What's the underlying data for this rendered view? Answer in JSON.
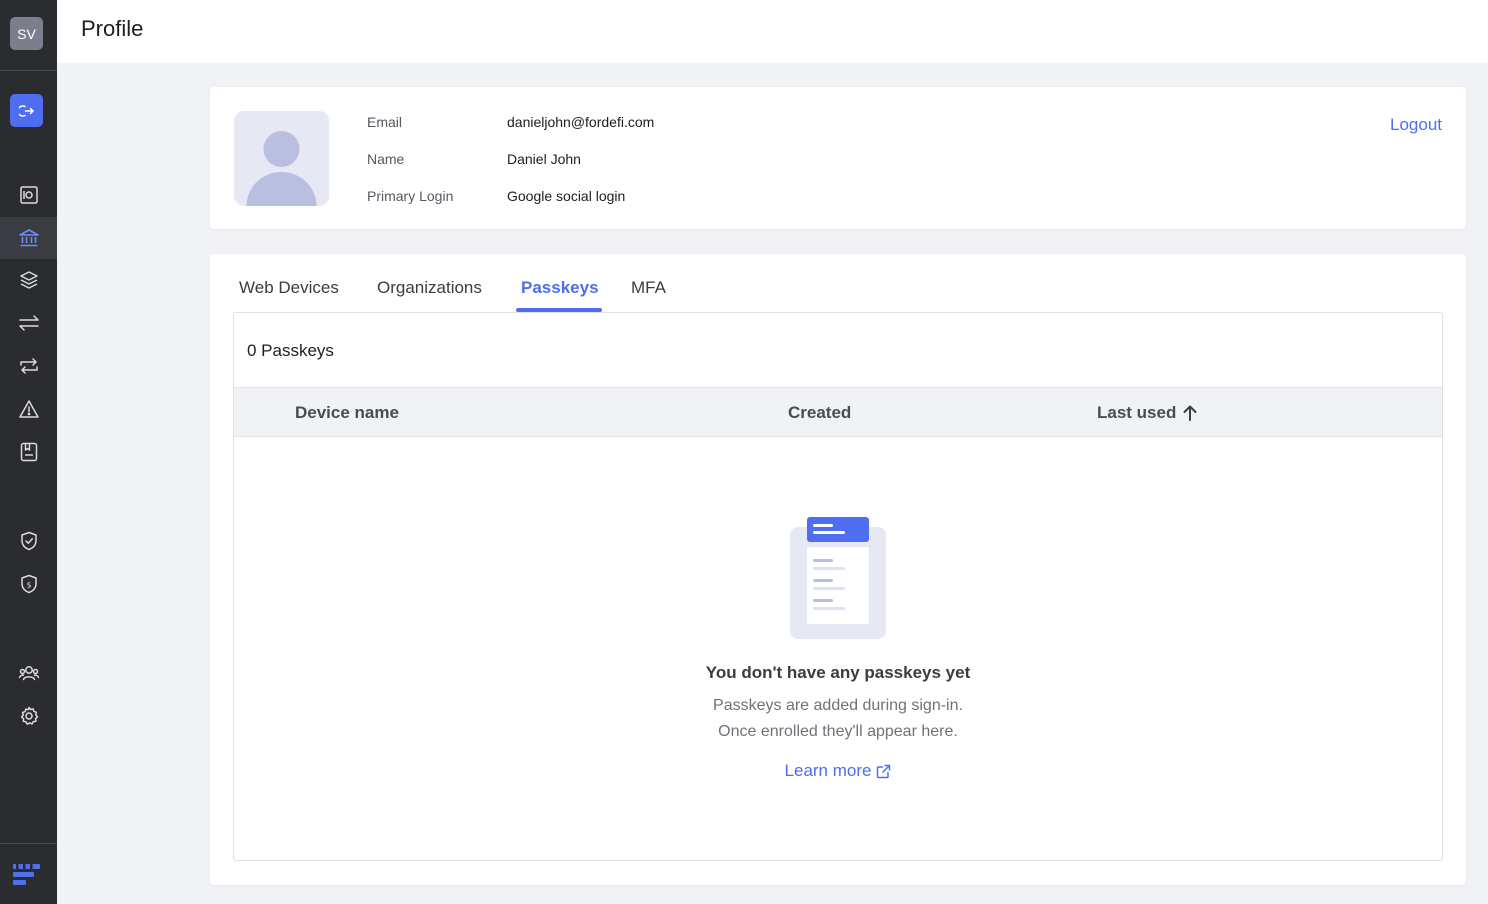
{
  "sidebar": {
    "user_initials": "SV",
    "items": [
      {
        "name": "vaults",
        "icon": "vault-icon"
      },
      {
        "name": "assets",
        "icon": "bank-icon",
        "active": true
      },
      {
        "name": "layers",
        "icon": "layers-icon"
      },
      {
        "name": "transactions",
        "icon": "transfer-icon"
      },
      {
        "name": "swaps",
        "icon": "repeat-icon"
      },
      {
        "name": "alerts",
        "icon": "warning-icon"
      },
      {
        "name": "address-book",
        "icon": "book-icon"
      },
      {
        "name": "policies",
        "icon": "shield-check-icon"
      },
      {
        "name": "billing",
        "icon": "shield-dollar-icon"
      },
      {
        "name": "users",
        "icon": "users-icon"
      },
      {
        "name": "settings",
        "icon": "gear-icon"
      }
    ]
  },
  "header": {
    "title": "Profile"
  },
  "profile": {
    "email_label": "Email",
    "email_value": "danieljohn@fordefi.com",
    "name_label": "Name",
    "name_value": "Daniel John",
    "login_label": "Primary Login",
    "login_value": "Google social login",
    "logout_label": "Logout"
  },
  "tabs": [
    {
      "label": "Web Devices"
    },
    {
      "label": "Organizations"
    },
    {
      "label": "Passkeys",
      "active": true
    },
    {
      "label": "MFA"
    }
  ],
  "passkeys": {
    "count_label": "0 Passkeys",
    "columns": [
      "Device name",
      "Created",
      "Last used"
    ],
    "sort_column": "Last used",
    "sort_direction": "ascending",
    "empty_title": "You don't have any passkeys yet",
    "empty_line1": "Passkeys are added during sign-in.",
    "empty_line2": "Once enrolled they'll appear here.",
    "learn_more": "Learn more"
  },
  "colors": {
    "accent": "#4f6df0",
    "sidebar_bg": "#2b2c2f",
    "page_bg": "#f1f2f5"
  }
}
